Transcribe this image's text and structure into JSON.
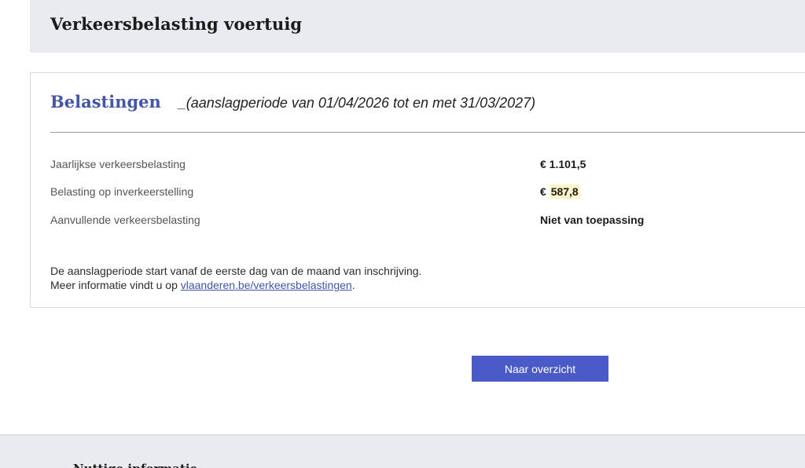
{
  "header": {
    "title": "Verkeersbelasting voertuig"
  },
  "card": {
    "title": "Belastingen",
    "period": "_(aanslagperiode van 01/04/2026 tot en met 31/03/2027)",
    "rows": [
      {
        "label": "Jaarlijkse verkeersbelasting",
        "value": "€ 1.101,5"
      },
      {
        "label": "Belasting op inverkeerstelling",
        "value": "€ 587,8",
        "highlighted": true
      },
      {
        "label": "Aanvullende verkeersbelasting",
        "value": "Niet van toepassing"
      }
    ],
    "info_line1": "De aanslagperiode start vanaf de eerste dag van de maand van inschrijving.",
    "info_line2_prefix": "Meer informatie vindt u op ",
    "info_link": "vlaanderen.be/verkeersbelastingen",
    "info_line2_suffix": "."
  },
  "actions": {
    "overview_label": "Naar overzicht"
  },
  "footer": {
    "title": "Nuttige informatie"
  },
  "colors": {
    "accent": "#4356a8",
    "button": "#4a5bc8",
    "band": "#e9ebf0",
    "highlight": "#fbf4c7"
  }
}
